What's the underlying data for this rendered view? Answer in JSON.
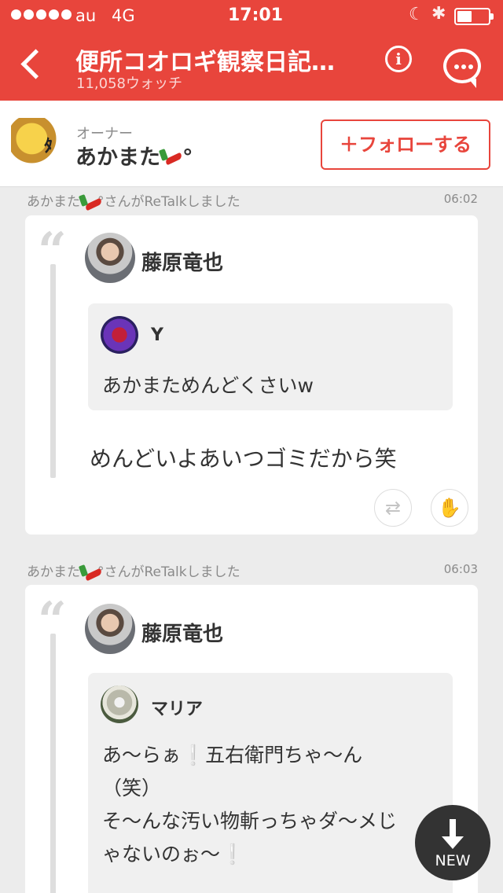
{
  "status": {
    "carrier": "au",
    "network": "4G",
    "time": "17:01"
  },
  "header": {
    "title": "便所コオロギ観察日記…",
    "watch_count": "11,058ウォッチ"
  },
  "owner": {
    "label": "オーナー",
    "name": "あかまた",
    "name_suffix": "°",
    "follow_label": "＋フォローする"
  },
  "feed": [
    {
      "retalk_text": "あかまた",
      "retalk_suffix": "°さんがReTalkしました",
      "timestamp": "06:02",
      "author": "藤原竜也",
      "quoted": {
        "author": "Y",
        "text": "あかまためんどくさいw"
      },
      "comment": "めんどいよあいつゴミだから笑"
    },
    {
      "retalk_text": "あかまた",
      "retalk_suffix": "°さんがReTalkしました",
      "timestamp": "06:03",
      "author": "藤原竜也",
      "quoted": {
        "author": "マリア",
        "line1": "あ〜らぁ❕五右衛門ちゃ〜ん",
        "line2": "（笑）",
        "line3": "そ〜んな汚い物斬っちゃダ〜メじ",
        "line4": "ゃないのぉ〜❕"
      }
    }
  ],
  "new_button_label": "NEW",
  "colors": {
    "brand": "#e8453c",
    "background": "#ececec"
  }
}
